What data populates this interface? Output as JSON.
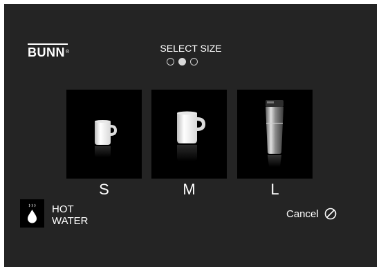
{
  "brand": {
    "name": "BUNN",
    "mark": "®"
  },
  "header": {
    "title": "SELECT SIZE"
  },
  "step_indicator": {
    "total": 3,
    "current": 2
  },
  "sizes": [
    {
      "label": "S",
      "icon": "small-mug-icon"
    },
    {
      "label": "M",
      "icon": "medium-mug-icon"
    },
    {
      "label": "L",
      "icon": "travel-tumbler-icon"
    }
  ],
  "hot_water": {
    "line1": "HOT",
    "line2": "WATER",
    "icon": "hot-water-drop-icon"
  },
  "cancel": {
    "label": "Cancel",
    "icon": "cancel-circle-icon"
  },
  "colors": {
    "background": "#242424",
    "tile": "#000000",
    "text": "#ffffff"
  }
}
